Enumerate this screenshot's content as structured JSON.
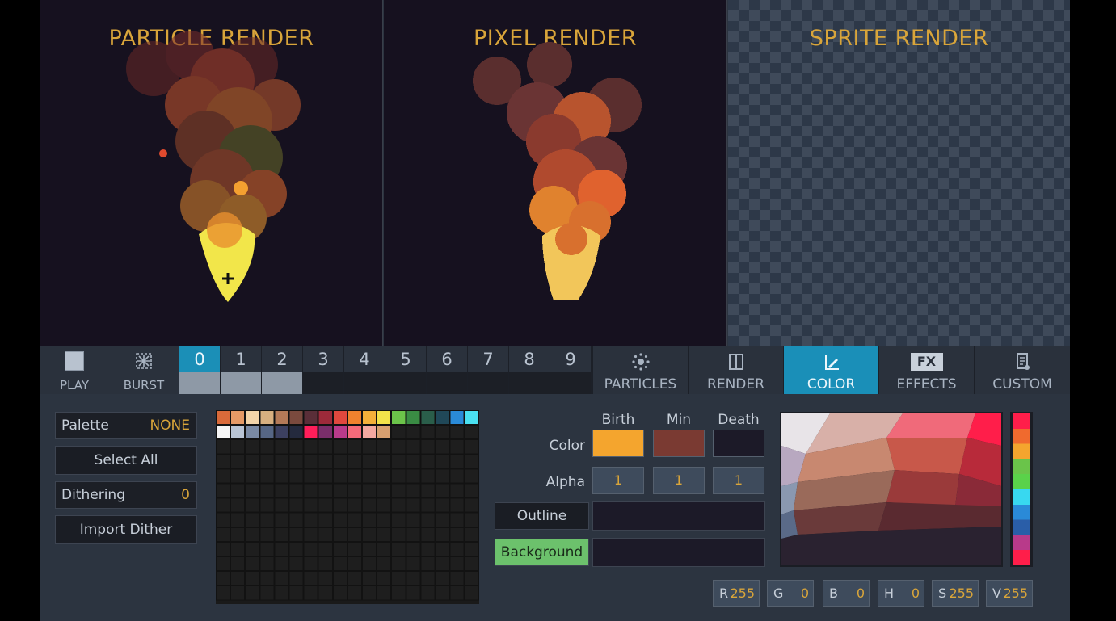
{
  "previews": {
    "particle_title": "PARTICLE RENDER",
    "pixel_title": "PIXEL RENDER",
    "sprite_title": "SPRITE RENDER"
  },
  "toolbar": {
    "play_label": "PLAY",
    "burst_label": "BURST",
    "slots": [
      {
        "label": "0",
        "active": true,
        "filled": true
      },
      {
        "label": "1",
        "active": false,
        "filled": true
      },
      {
        "label": "2",
        "active": false,
        "filled": true
      },
      {
        "label": "3",
        "active": false,
        "filled": false
      },
      {
        "label": "4",
        "active": false,
        "filled": false
      },
      {
        "label": "5",
        "active": false,
        "filled": false
      },
      {
        "label": "6",
        "active": false,
        "filled": false
      },
      {
        "label": "7",
        "active": false,
        "filled": false
      },
      {
        "label": "8",
        "active": false,
        "filled": false
      },
      {
        "label": "9",
        "active": false,
        "filled": false
      }
    ],
    "tabs": [
      {
        "label": "PARTICLES",
        "icon": "particles-icon",
        "active": false
      },
      {
        "label": "RENDER",
        "icon": "render-icon",
        "active": false
      },
      {
        "label": "COLOR",
        "icon": "color-icon",
        "active": true
      },
      {
        "label": "EFFECTS",
        "icon": "fx-icon",
        "active": false
      },
      {
        "label": "CUSTOM",
        "icon": "custom-icon",
        "active": false
      }
    ],
    "fx_icon_text": "FX"
  },
  "left_panel": {
    "palette_label": "Palette",
    "palette_value": "NONE",
    "select_all_label": "Select All",
    "dithering_label": "Dithering",
    "dithering_value": "0",
    "import_dither_label": "Import Dither"
  },
  "palette_colors": [
    "#d96a3a",
    "#e59a66",
    "#f2d4a8",
    "#d8b080",
    "#b47a58",
    "#7a4a3e",
    "#5a2e38",
    "#9c2a3a",
    "#e0483e",
    "#f0822e",
    "#f4b03a",
    "#f2e24a",
    "#6cc44a",
    "#3a8c44",
    "#2a5e4a",
    "#204858",
    "#2a8ad8",
    "#4ae0f0",
    "#f4f4f4",
    "#b8c4d4",
    "#7a8aa4",
    "#566684",
    "#3c4060",
    "#242a3e",
    "#ff1e5a",
    "#7a2e6a",
    "#b83a8a",
    "#f46a7a",
    "#f4a8a0",
    "#d8a070"
  ],
  "color_panel": {
    "col_headers": [
      "Birth",
      "Min",
      "Death"
    ],
    "color_label": "Color",
    "alpha_label": "Alpha",
    "birth_color": "#f4a52e",
    "min_color": "#7a3a32",
    "death_color": "#1c1a28",
    "alpha_values": [
      "1",
      "1",
      "1"
    ],
    "outline_label": "Outline",
    "background_label": "Background",
    "background_btn_color": "#6cc16c"
  },
  "hue_colors": [
    "#ff1e4a",
    "#f06a2e",
    "#f4a52e",
    "#6ac44a",
    "#5ad24a",
    "#38d8f0",
    "#2a8ad8",
    "#2a5ea8",
    "#b83a8a",
    "#ff1e4a"
  ],
  "channels": [
    {
      "k": "R",
      "v": "255"
    },
    {
      "k": "G",
      "v": "0"
    },
    {
      "k": "B",
      "v": "0"
    },
    {
      "k": "H",
      "v": "0"
    },
    {
      "k": "S",
      "v": "255"
    },
    {
      "k": "V",
      "v": "255"
    }
  ]
}
